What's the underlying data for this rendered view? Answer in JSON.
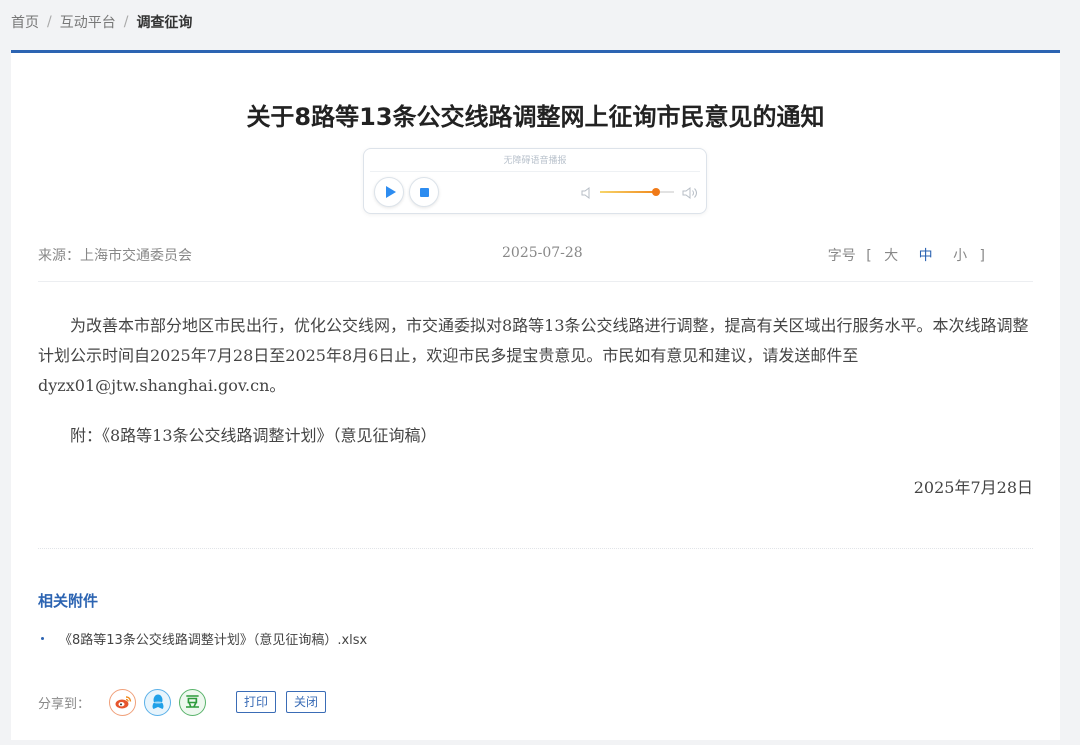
{
  "breadcrumb": {
    "home": "首页",
    "platform": "互动平台",
    "current": "调查征询",
    "separator": "/"
  },
  "article": {
    "title": "关于8路等13条公交线路调整网上征询市民意见的通知",
    "audio": {
      "caption": "无障碍语音播报",
      "volume_level": 0.75
    },
    "meta": {
      "source": "来源：上海市交通委员会",
      "date": "2025-07-28",
      "font_size_label": "字号",
      "bracket_open": "[",
      "bracket_close": "]",
      "size_large": "大",
      "size_medium": "中",
      "size_small": "小",
      "active_size": "中"
    },
    "body": {
      "paragraph": "为改善本市部分地区市民出行，优化公交线网，市交通委拟对8路等13条公交线路进行调整，提高有关区域出行服务水平。本次线路调整计划公示时间自2025年7月28日至2025年8月6日止，欢迎市民多提宝贵意见。市民如有意见和建议，请发送邮件至dyzx01@jtw.shanghai.gov.cn。",
      "attachment_line": "附：《8路等13条公交线路调整计划》（意见征询稿）",
      "signature_date": "2025年7月28日"
    },
    "related": {
      "title": "相关附件",
      "items": [
        "《8路等13条公交线路调整计划》（意见征询稿）.xlsx"
      ]
    },
    "share": {
      "label": "分享到：",
      "douban_glyph": "豆",
      "print_label": "打印",
      "close_label": "关闭"
    }
  },
  "colors": {
    "accent": "#2c64b2",
    "player_blue": "#2d8cf0",
    "slider_orange": "#f07a18",
    "weibo": "#e6552d",
    "qq": "#1fa0e8",
    "douban": "#2e9b3d"
  },
  "icons": [
    "play-icon",
    "stop-icon",
    "volume-low-icon",
    "volume-high-icon",
    "weibo-icon",
    "qq-icon",
    "douban-icon"
  ]
}
